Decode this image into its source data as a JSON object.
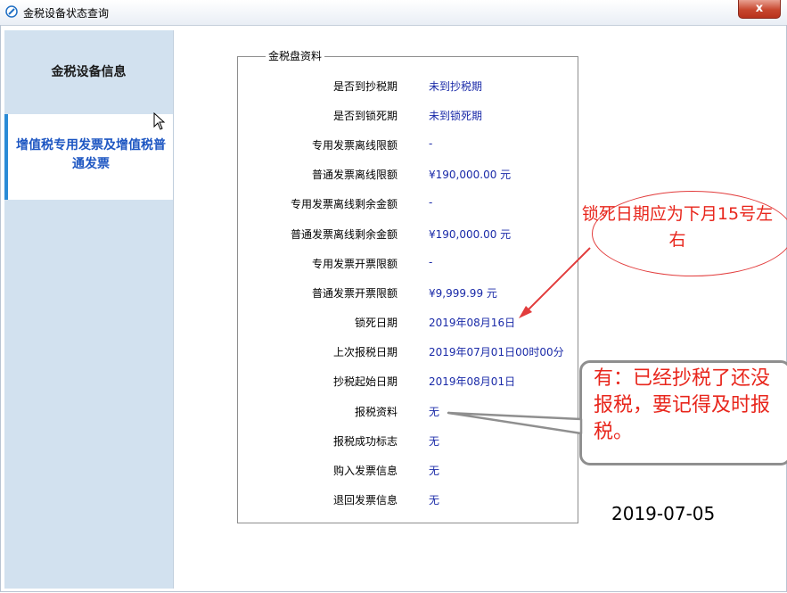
{
  "window": {
    "title": "金税设备状态查询",
    "close_label": "x"
  },
  "sidebar": {
    "items": [
      {
        "label": "金税设备信息"
      },
      {
        "label": "增值税专用发票及增值税普通发票"
      }
    ]
  },
  "group": {
    "legend": "金税盘资料",
    "rows": [
      {
        "label": "是否到抄税期",
        "value": "未到抄税期"
      },
      {
        "label": "是否到锁死期",
        "value": "未到锁死期"
      },
      {
        "label": "专用发票离线限额",
        "value": "-"
      },
      {
        "label": "普通发票离线限额",
        "value": "¥190,000.00 元"
      },
      {
        "label": "专用发票离线剩余金额",
        "value": "-"
      },
      {
        "label": "普通发票离线剩余金额",
        "value": "¥190,000.00 元"
      },
      {
        "label": "专用发票开票限额",
        "value": "-"
      },
      {
        "label": "普通发票开票限额",
        "value": "¥9,999.99 元"
      },
      {
        "label": "锁死日期",
        "value": "2019年08月16日"
      },
      {
        "label": "上次报税日期",
        "value": "2019年07月01日00时00分"
      },
      {
        "label": "抄税起始日期",
        "value": "2019年08月01日"
      },
      {
        "label": "报税资料",
        "value": "无"
      },
      {
        "label": "报税成功标志",
        "value": "无"
      },
      {
        "label": "购入发票信息",
        "value": "无"
      },
      {
        "label": "退回发票信息",
        "value": "无"
      }
    ]
  },
  "annotations": {
    "lock_note": "锁死日期应为下月15号左右",
    "tax_note": "有：已经抄税了还没报税，要记得及时报税。",
    "date": "2019-07-05"
  },
  "colors": {
    "accent": "#2a8bd6",
    "value_text": "#1a2aa8",
    "annotation": "#e8261c"
  }
}
